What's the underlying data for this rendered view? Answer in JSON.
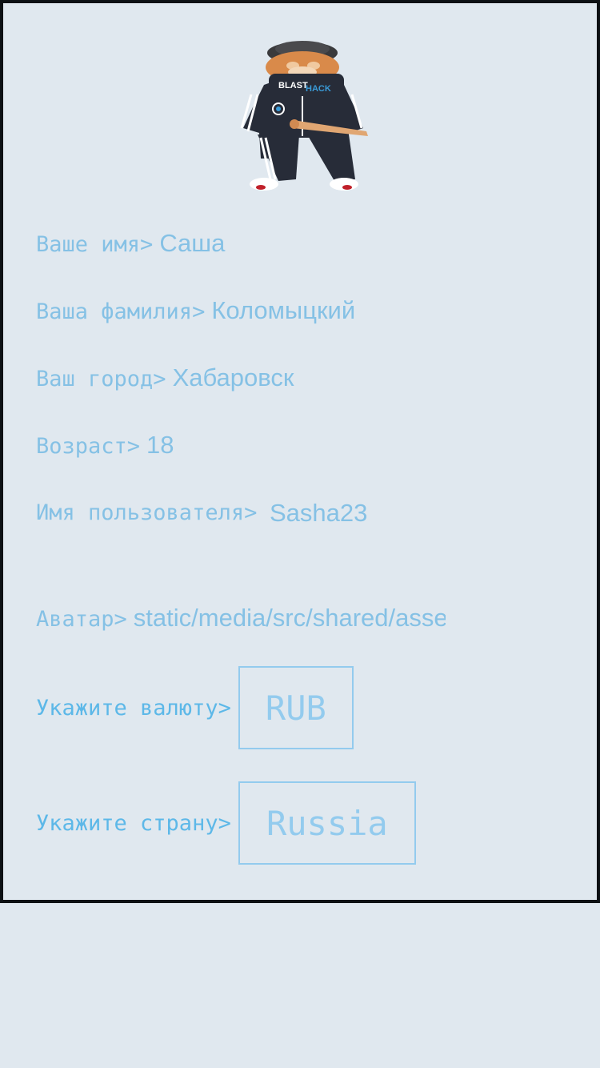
{
  "profile": {
    "fields": {
      "name": {
        "label": "Ваше имя>",
        "value": "Саша"
      },
      "surname": {
        "label": "Ваша фамилия>",
        "value": "Коломыцкий"
      },
      "city": {
        "label": "Ваш город>",
        "value": "Хабаровск"
      },
      "age": {
        "label": "Возраст>",
        "value": "18"
      },
      "username": {
        "label": "Имя пользователя>",
        "value": "Sasha23"
      },
      "avatar": {
        "label": "Аватар>",
        "value": "static/media/src/shared/assets"
      }
    },
    "currency": {
      "label": "Укажите валюту>",
      "selected": "RUB"
    },
    "country": {
      "label": "Укажите страну>",
      "selected": "Russia"
    },
    "avatar_image": {
      "icon": "cat-in-tracksuit-avatar",
      "logo_text_1": "BLAST",
      "logo_text_2": "HACK"
    }
  },
  "colors": {
    "background": "#e0e8ef",
    "border": "#0d1114",
    "text": "#85c1e5",
    "accent": "#5db8e8"
  }
}
